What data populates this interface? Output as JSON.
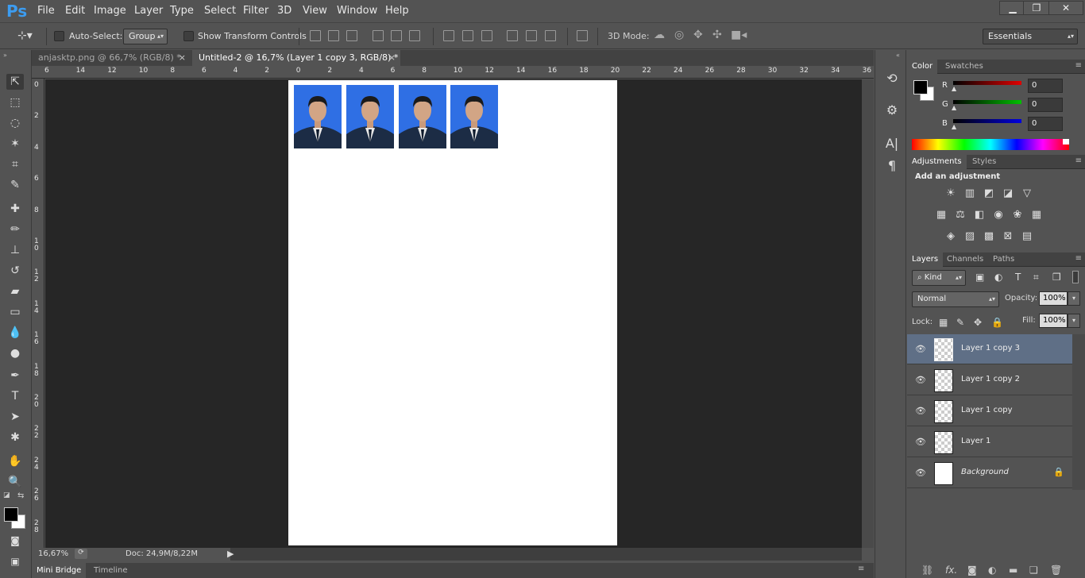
{
  "app": {
    "logo": "Ps"
  },
  "menu": [
    "File",
    "Edit",
    "Image",
    "Layer",
    "Type",
    "Select",
    "Filter",
    "3D",
    "View",
    "Window",
    "Help"
  ],
  "window_buttons": {
    "minimize": "▁",
    "restore": "❐",
    "close": "✕"
  },
  "options": {
    "auto_select_label": "Auto-Select:",
    "auto_select_mode": "Group",
    "show_transform_label": "Show Transform Controls",
    "mode_3d_label": "3D Mode:",
    "workspace": "Essentials"
  },
  "tabs": [
    {
      "title": "anjasktp.png @ 66,7% (RGB/8) *",
      "close": "×"
    },
    {
      "title": "Untitled-2 @ 16,7% (Layer 1 copy 3, RGB/8) *",
      "close": "×"
    }
  ],
  "ruler_h": [
    "6",
    "14",
    "12",
    "10",
    "8",
    "6",
    "4",
    "2",
    "0",
    "2",
    "4",
    "6",
    "8",
    "10",
    "12",
    "14",
    "16",
    "18",
    "20",
    "22",
    "24",
    "26",
    "28",
    "30",
    "32",
    "34",
    "36"
  ],
  "ruler_v": [
    "0",
    "2",
    "4",
    "6",
    "8",
    "10",
    "12",
    "14",
    "16",
    "18",
    "20",
    "22",
    "24",
    "26",
    "28"
  ],
  "status": {
    "zoom": "16,67%",
    "doc": "Doc: 24,9M/8,22M"
  },
  "bottom_tabs": [
    "Mini Bridge",
    "Timeline"
  ],
  "color_panel": {
    "tabs": [
      "Color",
      "Swatches"
    ],
    "channels": [
      {
        "label": "R",
        "value": "0",
        "color": "#e00000"
      },
      {
        "label": "G",
        "value": "0",
        "color": "#00c000"
      },
      {
        "label": "B",
        "value": "0",
        "color": "#0000e0"
      }
    ]
  },
  "adjustments_panel": {
    "tabs": [
      "Adjustments",
      "Styles"
    ],
    "heading": "Add an adjustment"
  },
  "layers_panel": {
    "tabs": [
      "Layers",
      "Channels",
      "Paths"
    ],
    "filter_kind": "Kind",
    "blend_mode": "Normal",
    "opacity_label": "Opacity:",
    "opacity_value": "100%",
    "lock_label": "Lock:",
    "fill_label": "Fill:",
    "fill_value": "100%",
    "layers": [
      {
        "name": "Layer 1 copy 3",
        "active": true
      },
      {
        "name": "Layer 1 copy 2",
        "active": false
      },
      {
        "name": "Layer 1 copy",
        "active": false
      },
      {
        "name": "Layer 1",
        "active": false
      },
      {
        "name": "Background",
        "active": false
      }
    ]
  }
}
